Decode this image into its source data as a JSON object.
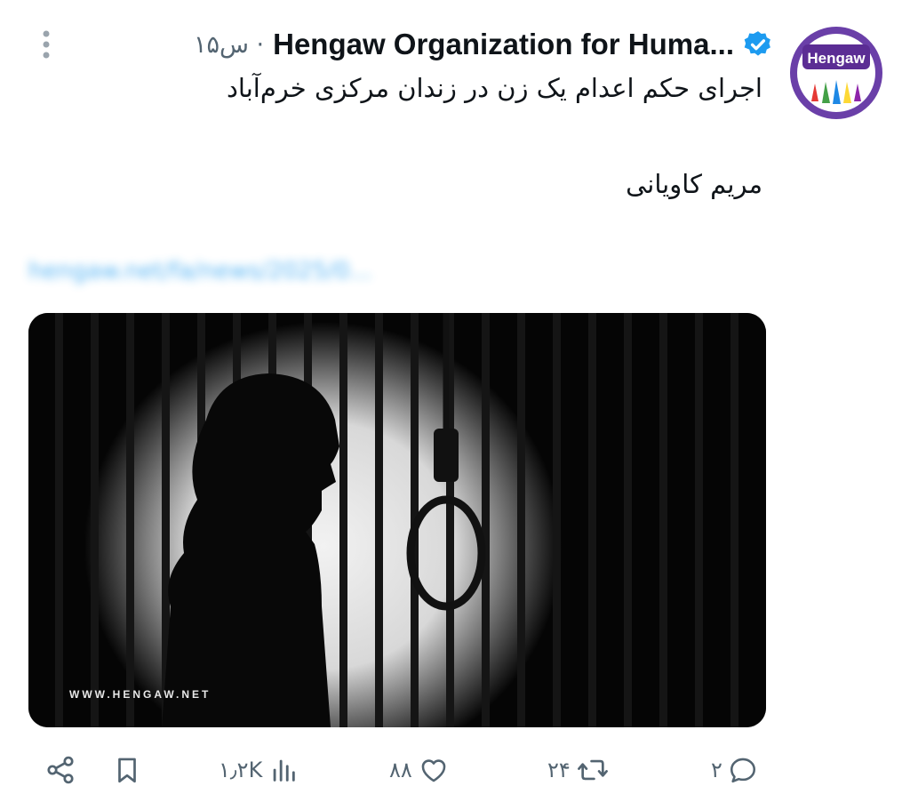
{
  "tweet": {
    "author_name": "Hengaw Organization for Huma...",
    "time": "۱۵س ·",
    "text_line1": "اجرای حکم اعدام یک زن در زندان مرکزی خرم‌آباد",
    "text_line2": "مریم کاویانی",
    "link_text": "hengaw.net/fa/news/2025/0...",
    "avatar_text": "Hengaw",
    "media_watermark": "WWW.HENGAW.NET"
  },
  "actions": {
    "replies": "۲",
    "retweets": "۲۴",
    "likes": "۸۸",
    "views": "۱٫۲K"
  },
  "colors": {
    "accent": "#1d9bf0",
    "secondary_text": "#536471",
    "avatar_ring": "#6a3fa8"
  },
  "icons": [
    "more-icon",
    "verified-badge-icon",
    "reply-icon",
    "retweet-icon",
    "like-icon",
    "views-icon",
    "bookmark-icon",
    "share-icon"
  ]
}
